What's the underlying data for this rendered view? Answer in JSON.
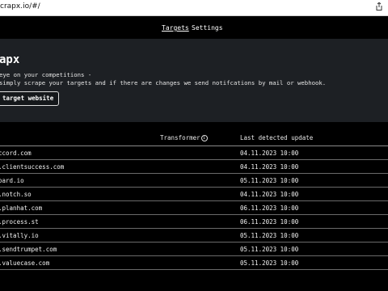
{
  "browser": {
    "url_text": "crapx.io/#/"
  },
  "nav": {
    "items": [
      {
        "label": "Targets",
        "active": true
      },
      {
        "label": "Settings",
        "active": false
      }
    ]
  },
  "hero": {
    "title": "apx",
    "line1": " eye on your competitions -",
    "line2": " simply scrape your targets and if there are changes we send notifcations by mail or webhook.",
    "cta_label": "target website"
  },
  "table": {
    "headers": {
      "transformer": "Transformer",
      "last_update": "Last detected update"
    },
    "rows": [
      {
        "target": "ccord.com",
        "date": "04.11.2023 10:00"
      },
      {
        "target": ".clientsuccess.com",
        "date": "04.11.2023 10:00"
      },
      {
        "target": "oard.io",
        "date": "05.11.2023 10:00"
      },
      {
        "target": ".notch.so",
        "date": "04.11.2023 10:00"
      },
      {
        "target": ".planhat.com",
        "date": "06.11.2023 10:00"
      },
      {
        "target": ".process.st",
        "date": "06.11.2023 10:00"
      },
      {
        "target": ".vitally.io",
        "date": "05.11.2023 10:00"
      },
      {
        "target": ".sendtrumpet.com",
        "date": "05.11.2023 10:00"
      },
      {
        "target": ".valuecase.com",
        "date": "05.11.2023 10:00"
      }
    ]
  },
  "colors": {
    "background": "#000000",
    "hero_background": "#1d2024",
    "text": "#ffffff"
  },
  "icons": [
    "share-icon",
    "info-icon"
  ]
}
